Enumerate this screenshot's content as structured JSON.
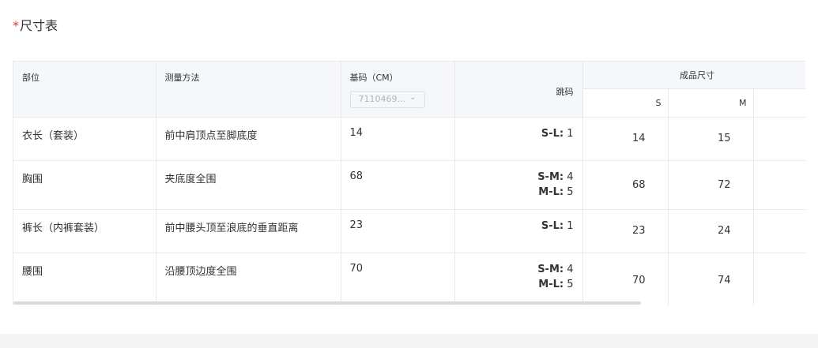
{
  "section": {
    "required_mark": "*",
    "title": "尺寸表"
  },
  "headers": {
    "part": "部位",
    "method": "测量方法",
    "base": "基码（CM）",
    "base_select_value": "7110469...",
    "jump": "跳码",
    "finished": "成品尺寸",
    "sizes": [
      "S",
      "M"
    ]
  },
  "rows": [
    {
      "part": "衣长（套装）",
      "method": "前中肩顶点至脚底度",
      "base": "14",
      "jump": [
        {
          "range": "S-L:",
          "value": " 1"
        }
      ],
      "sizes": [
        "14",
        "15"
      ]
    },
    {
      "part": "胸围",
      "method": "夹底度全围",
      "base": "68",
      "jump": [
        {
          "range": "S-M:",
          "value": " 4"
        },
        {
          "range": "M-L:",
          "value": " 5"
        }
      ],
      "sizes": [
        "68",
        "72"
      ]
    },
    {
      "part": "裤长（内裤套装）",
      "method": "前中腰头顶至浪底的垂直距离",
      "base": "23",
      "jump": [
        {
          "range": "S-L:",
          "value": " 1"
        }
      ],
      "sizes": [
        "23",
        "24"
      ]
    },
    {
      "part": "腰围",
      "method": "沿腰顶边度全围",
      "base": "70",
      "jump": [
        {
          "range": "S-M:",
          "value": " 4"
        },
        {
          "range": "M-L:",
          "value": " 5"
        }
      ],
      "sizes": [
        "70",
        "74"
      ]
    }
  ],
  "icons": {
    "select_chevron": "chevron-down-icon"
  },
  "colors": {
    "required": "#e4393c",
    "header_bg": "#f5f7fa",
    "border": "#e8e8e8"
  }
}
